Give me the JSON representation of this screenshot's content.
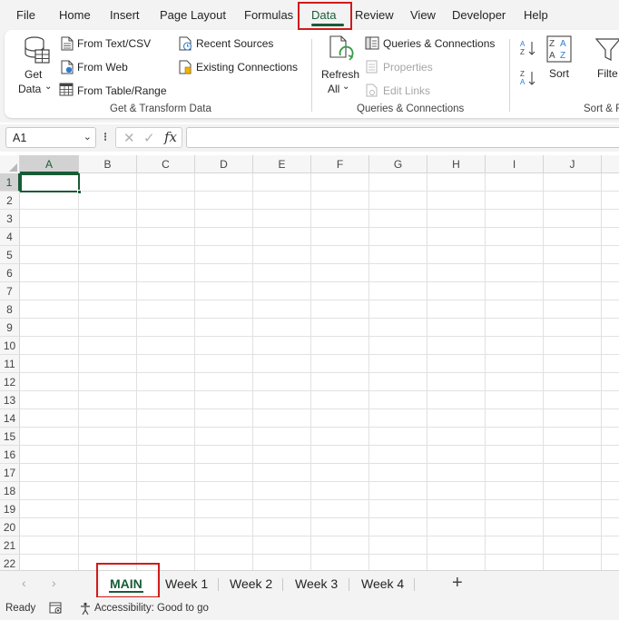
{
  "menu": {
    "items": [
      "File",
      "Home",
      "Insert",
      "Page Layout",
      "Formulas",
      "Data",
      "Review",
      "View",
      "Developer",
      "Help"
    ],
    "active": "Data"
  },
  "ribbon": {
    "get_data": {
      "line1": "Get",
      "line2": "Data"
    },
    "from_text_csv": "From Text/CSV",
    "from_web": "From Web",
    "from_table_range": "From Table/Range",
    "recent_sources": "Recent Sources",
    "existing_connections": "Existing Connections",
    "group_get_transform": "Get & Transform Data",
    "refresh_all": {
      "line1": "Refresh",
      "line2": "All"
    },
    "queries_connections": "Queries & Connections",
    "properties": "Properties",
    "edit_links": "Edit Links",
    "group_queries": "Queries & Connections",
    "sort": "Sort",
    "filter": "Filte",
    "group_sort": "Sort & F"
  },
  "formula_bar": {
    "name_box": "A1",
    "fx_label": "fx",
    "formula": ""
  },
  "grid": {
    "columns": [
      "A",
      "B",
      "C",
      "D",
      "E",
      "F",
      "G",
      "H",
      "I",
      "J"
    ],
    "rows": [
      "1",
      "2",
      "3",
      "4",
      "5",
      "6",
      "7",
      "8",
      "9",
      "10",
      "11",
      "12",
      "13",
      "14",
      "15",
      "16",
      "17",
      "18",
      "19",
      "20",
      "21",
      "22"
    ],
    "selected_cell": "A1"
  },
  "sheets": {
    "tabs": [
      "MAIN",
      "Week 1",
      "Week 2",
      "Week 3",
      "Week 4"
    ],
    "active": "MAIN"
  },
  "status": {
    "ready": "Ready",
    "accessibility": "Accessibility: Good to go"
  },
  "colors": {
    "accent": "#185c37",
    "highlight": "#d11a1a"
  }
}
